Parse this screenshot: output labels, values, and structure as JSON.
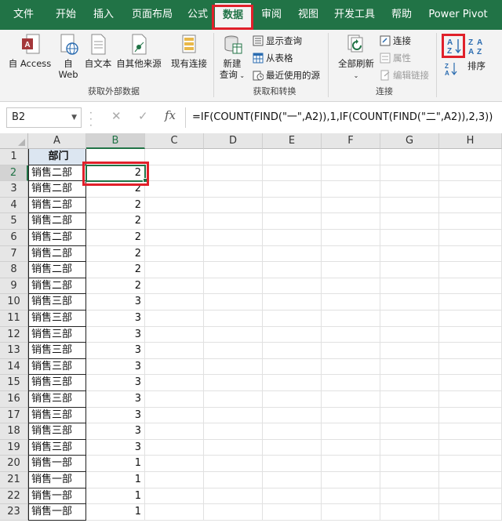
{
  "tabs": [
    {
      "label": "文件"
    },
    {
      "label": "开始"
    },
    {
      "label": "插入"
    },
    {
      "label": "页面布局"
    },
    {
      "label": "公式"
    },
    {
      "label": "数据"
    },
    {
      "label": "审阅"
    },
    {
      "label": "视图"
    },
    {
      "label": "开发工具"
    },
    {
      "label": "帮助"
    },
    {
      "label": "Power Pivot"
    }
  ],
  "active_tab": "数据",
  "ribbon": {
    "get_external": {
      "group_label": "获取外部数据",
      "from_access": {
        "line1": "自 Access",
        "icon": "access-database-icon"
      },
      "from_web": {
        "line1": "自",
        "line2": "Web",
        "icon": "web-globe-icon"
      },
      "from_text": {
        "line1": "自文本",
        "icon": "text-file-icon"
      },
      "from_other": {
        "line1": "自其他来源",
        "icon": "other-sources-icon"
      },
      "existing": {
        "line1": "现有连接",
        "icon": "existing-connections-icon"
      }
    },
    "get_transform": {
      "group_label": "获取和转换",
      "new_query": {
        "line1": "新建",
        "line2": "查询",
        "icon": "new-query-icon"
      },
      "show_queries": "显示查询",
      "from_table": "从表格",
      "recent_sources": "最近使用的源"
    },
    "connections": {
      "group_label": "连接",
      "refresh_all": {
        "line1": "全部刷新",
        "icon": "refresh-all-icon"
      },
      "connections": "连接",
      "properties": "属性",
      "edit_links": "编辑链接"
    },
    "sort": {
      "sort_asc_icon": "sort-ascending-icon",
      "sort_desc_icon": "sort-descending-icon",
      "sort_label": "排序"
    }
  },
  "formula_bar": {
    "name_box": "B2",
    "fx": "fx",
    "formula": "=IF(COUNT(FIND(\"一\",A2)),1,IF(COUNT(FIND(\"二\",A2)),2,3))"
  },
  "grid": {
    "columns": [
      "A",
      "B",
      "C",
      "D",
      "E",
      "F",
      "G",
      "H"
    ],
    "selected_column": "B",
    "selected_row": 2,
    "active_cell": "B2",
    "rows": [
      {
        "n": "1",
        "a": "部门",
        "b": ""
      },
      {
        "n": "2",
        "a": "销售二部",
        "b": "2"
      },
      {
        "n": "3",
        "a": "销售二部",
        "b": "2"
      },
      {
        "n": "4",
        "a": "销售二部",
        "b": "2"
      },
      {
        "n": "5",
        "a": "销售二部",
        "b": "2"
      },
      {
        "n": "6",
        "a": "销售二部",
        "b": "2"
      },
      {
        "n": "7",
        "a": "销售二部",
        "b": "2"
      },
      {
        "n": "8",
        "a": "销售二部",
        "b": "2"
      },
      {
        "n": "9",
        "a": "销售二部",
        "b": "2"
      },
      {
        "n": "10",
        "a": "销售三部",
        "b": "3"
      },
      {
        "n": "11",
        "a": "销售三部",
        "b": "3"
      },
      {
        "n": "12",
        "a": "销售三部",
        "b": "3"
      },
      {
        "n": "13",
        "a": "销售三部",
        "b": "3"
      },
      {
        "n": "14",
        "a": "销售三部",
        "b": "3"
      },
      {
        "n": "15",
        "a": "销售三部",
        "b": "3"
      },
      {
        "n": "16",
        "a": "销售三部",
        "b": "3"
      },
      {
        "n": "17",
        "a": "销售三部",
        "b": "3"
      },
      {
        "n": "18",
        "a": "销售三部",
        "b": "3"
      },
      {
        "n": "19",
        "a": "销售三部",
        "b": "3"
      },
      {
        "n": "20",
        "a": "销售一部",
        "b": "1"
      },
      {
        "n": "21",
        "a": "销售一部",
        "b": "1"
      },
      {
        "n": "22",
        "a": "销售一部",
        "b": "1"
      },
      {
        "n": "23",
        "a": "销售一部",
        "b": "1"
      }
    ]
  },
  "colors": {
    "excel_green": "#217346",
    "highlight_red": "#e0202a",
    "header_fill": "#dce6f1"
  }
}
